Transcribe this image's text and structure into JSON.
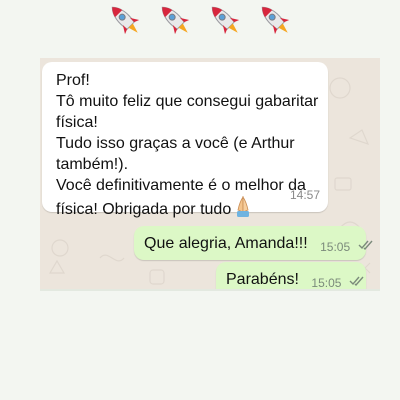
{
  "header": {
    "decoration_icons": [
      "rocket-icon",
      "rocket-icon",
      "rocket-icon",
      "rocket-icon"
    ]
  },
  "chat": {
    "messages": [
      {
        "direction": "incoming",
        "lines": [
          "Prof!",
          "Tô muito feliz que consegui gabaritar",
          "física!",
          "Tudo isso graças a você (e Arthur",
          "também!).",
          "Você definitivamente é o melhor da",
          "física! Obrigada por tudo"
        ],
        "emoji": "folded-hands-icon",
        "time": "14:57"
      },
      {
        "direction": "outgoing",
        "text": "Que alegria, Amanda!!!",
        "time": "15:05",
        "status": "read"
      },
      {
        "direction": "outgoing",
        "text": "Parabéns!",
        "time": "15:05",
        "status": "read"
      }
    ]
  },
  "colors": {
    "incoming_bubble": "#ffffff",
    "outgoing_bubble": "#dcf8c6",
    "chat_background": "#ece5dc",
    "read_ticks": "#7b8a7b"
  }
}
